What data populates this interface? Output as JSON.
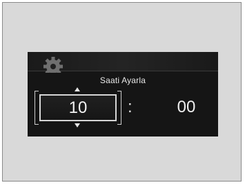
{
  "screen": {
    "title": "Saati Ayarla",
    "settings_icon": "gear-icon",
    "hour": "10",
    "separator": ":",
    "minute": "00"
  }
}
